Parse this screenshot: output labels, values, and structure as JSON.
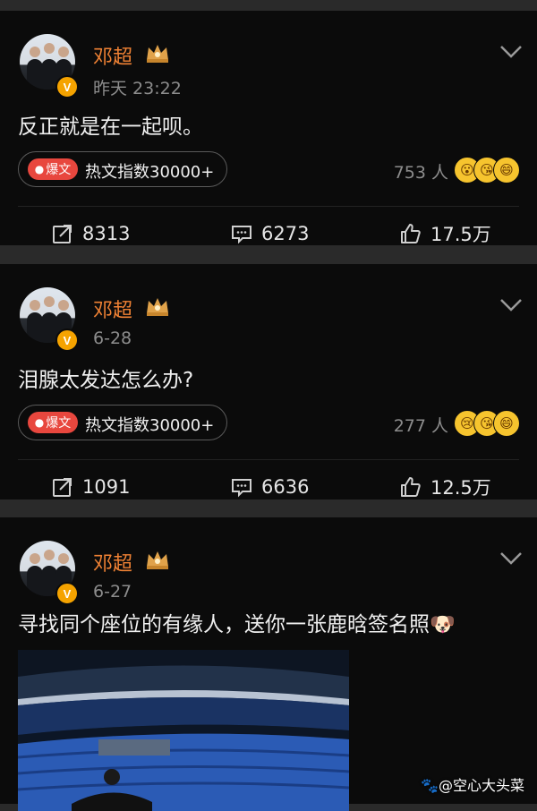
{
  "posts": [
    {
      "author": "邓超",
      "time": "昨天 23:22",
      "content": "反正就是在一起呗。",
      "hot_badge": "爆文",
      "hot_label": "热文指数30000+",
      "reactions": "753 人",
      "emojis": [
        "😮",
        "😘",
        "😄"
      ],
      "repost": "8313",
      "comment": "6273",
      "like": "17.5万"
    },
    {
      "author": "邓超",
      "time": "6-28",
      "content": "泪腺太发达怎么办?",
      "hot_badge": "爆文",
      "hot_label": "热文指数30000+",
      "reactions": "277 人",
      "emojis": [
        "😢",
        "😘",
        "😄"
      ],
      "repost": "1091",
      "comment": "6636",
      "like": "12.5万"
    },
    {
      "author": "邓超",
      "time": "6-27",
      "content": "寻找同个座位的有缘人，送你一张鹿晗签名照",
      "content_emoji": "🐶"
    }
  ],
  "watermark": "🐾@空心大头菜",
  "colors": {
    "name": "#f08234",
    "badge": "#e8473e",
    "verified": "#f5a300"
  }
}
